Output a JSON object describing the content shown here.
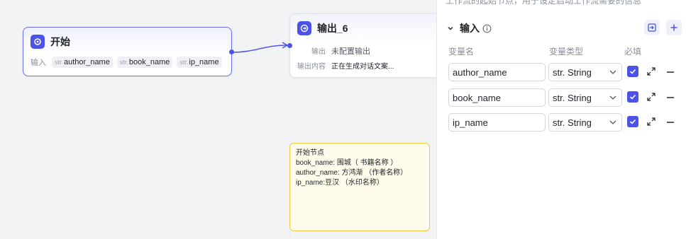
{
  "canvas": {
    "start_node": {
      "title": "开始",
      "input_label": "输入",
      "params": [
        {
          "prefix": "str.",
          "name": "author_name"
        },
        {
          "prefix": "str.",
          "name": "book_name"
        },
        {
          "prefix": "str.",
          "name": "ip_name"
        }
      ]
    },
    "output_node": {
      "title": "输出_6",
      "output_label": "输出",
      "output_value": "未配置输出",
      "content_label": "输出内容",
      "content_value": "正在生成对话文案..."
    },
    "note": {
      "lines": [
        "开始节点",
        "",
        "book_name: 围城（ 书籍名称 ）",
        "author_name: 方鸿渐 （作者名称）",
        "ip_name:豆汉 （水印名称）"
      ]
    }
  },
  "panel": {
    "clipped_top_text": "工作流的起始节点，用于设定启动工作流需要的信息",
    "section_title": "输入",
    "columns": {
      "name": "变量名",
      "type": "变量类型",
      "required": "必填"
    },
    "variables": [
      {
        "name": "author_name",
        "type": "str. String",
        "required": true
      },
      {
        "name": "book_name",
        "type": "str. String",
        "required": true
      },
      {
        "name": "ip_name",
        "type": "str. String",
        "required": true
      }
    ]
  },
  "colors": {
    "accent": "#4d53e8",
    "note_bg": "#fffbea",
    "note_border": "#f5c842"
  }
}
